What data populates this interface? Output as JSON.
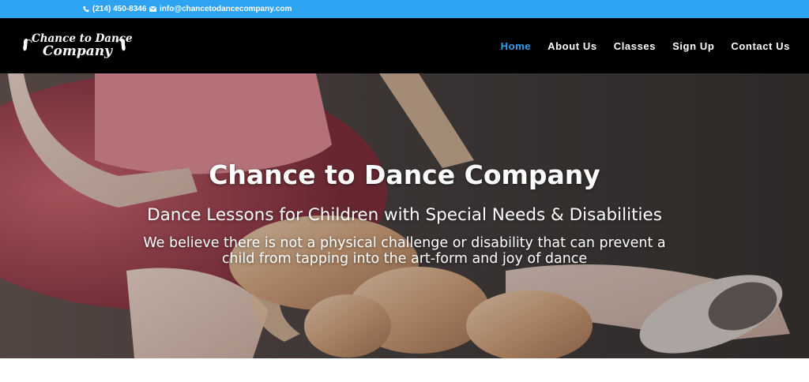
{
  "topbar": {
    "phone": "(214) 450-8346",
    "email": "info@chancetodancecompany.com",
    "background_color": "#2ea3f2",
    "phone_icon": "phone-icon",
    "email_icon": "envelope-icon"
  },
  "header": {
    "logo_line1": "Chance to Dance",
    "logo_line2": "Company",
    "logo_icon": "ballet-shoes-icon",
    "nav": [
      {
        "label": "Home",
        "active": true
      },
      {
        "label": "About Us",
        "active": false
      },
      {
        "label": "Classes",
        "active": false
      },
      {
        "label": "Sign Up",
        "active": false
      },
      {
        "label": "Contact Us",
        "active": false
      }
    ],
    "accent_color": "#2ea3f2"
  },
  "hero": {
    "title": "Chance to Dance Company",
    "subtitle": "Dance Lessons for Children with Special Needs & Disabilities",
    "text": "We believe there is not a physical challenge or disability that can prevent a child from tapping into the art-form and joy of dance"
  }
}
